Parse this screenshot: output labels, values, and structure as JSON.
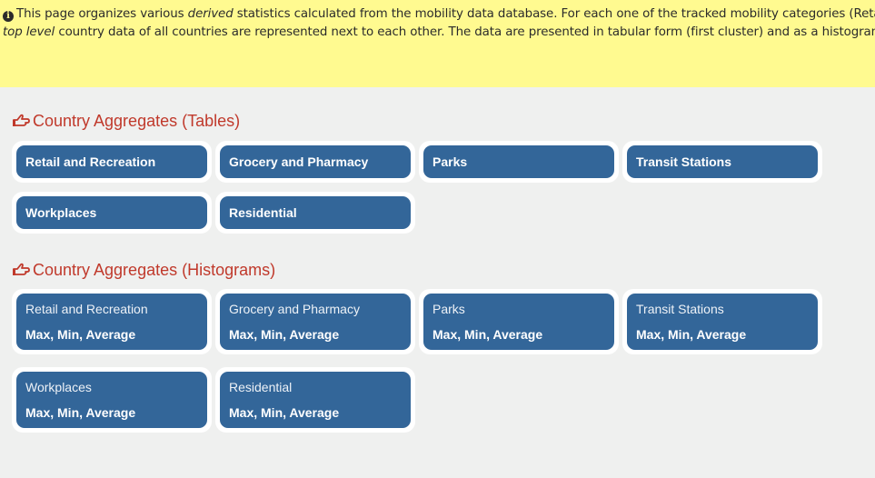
{
  "info_banner": {
    "icon": "info-circle-icon",
    "line1_pre": "This page organizes various ",
    "line1_em": "derived",
    "line1_post": " statistics calculated from the mobility data database. For each one of the tracked mobility categories (Retail, W",
    "line2_em": "top level",
    "line2_post": " country data of all countries are represented next to each other. The data are presented in tabular form (first cluster) and as a histogram to"
  },
  "sections": [
    {
      "title": "Country Aggregates (Tables)",
      "icon": "hand-point-right-icon",
      "tiles": [
        {
          "label": "Retail and Recreation"
        },
        {
          "label": "Grocery and Pharmacy"
        },
        {
          "label": "Parks"
        },
        {
          "label": "Transit Stations"
        },
        {
          "label": "Workplaces"
        },
        {
          "label": "Residential"
        }
      ]
    },
    {
      "title": "Country Aggregates (Histograms)",
      "icon": "hand-point-right-icon",
      "tiles": [
        {
          "label": "Retail and Recreation",
          "sub": "Max, Min, Average"
        },
        {
          "label": "Grocery and Pharmacy",
          "sub": "Max, Min, Average"
        },
        {
          "label": "Parks",
          "sub": "Max, Min, Average"
        },
        {
          "label": "Transit Stations",
          "sub": "Max, Min, Average"
        },
        {
          "label": "Workplaces",
          "sub": "Max, Min, Average"
        },
        {
          "label": "Residential",
          "sub": "Max, Min, Average"
        }
      ]
    }
  ],
  "colors": {
    "banner_bg": "#fffa90",
    "tile_blue": "#336699",
    "section_title": "#c0392b",
    "page_bg": "#eff0ef"
  }
}
